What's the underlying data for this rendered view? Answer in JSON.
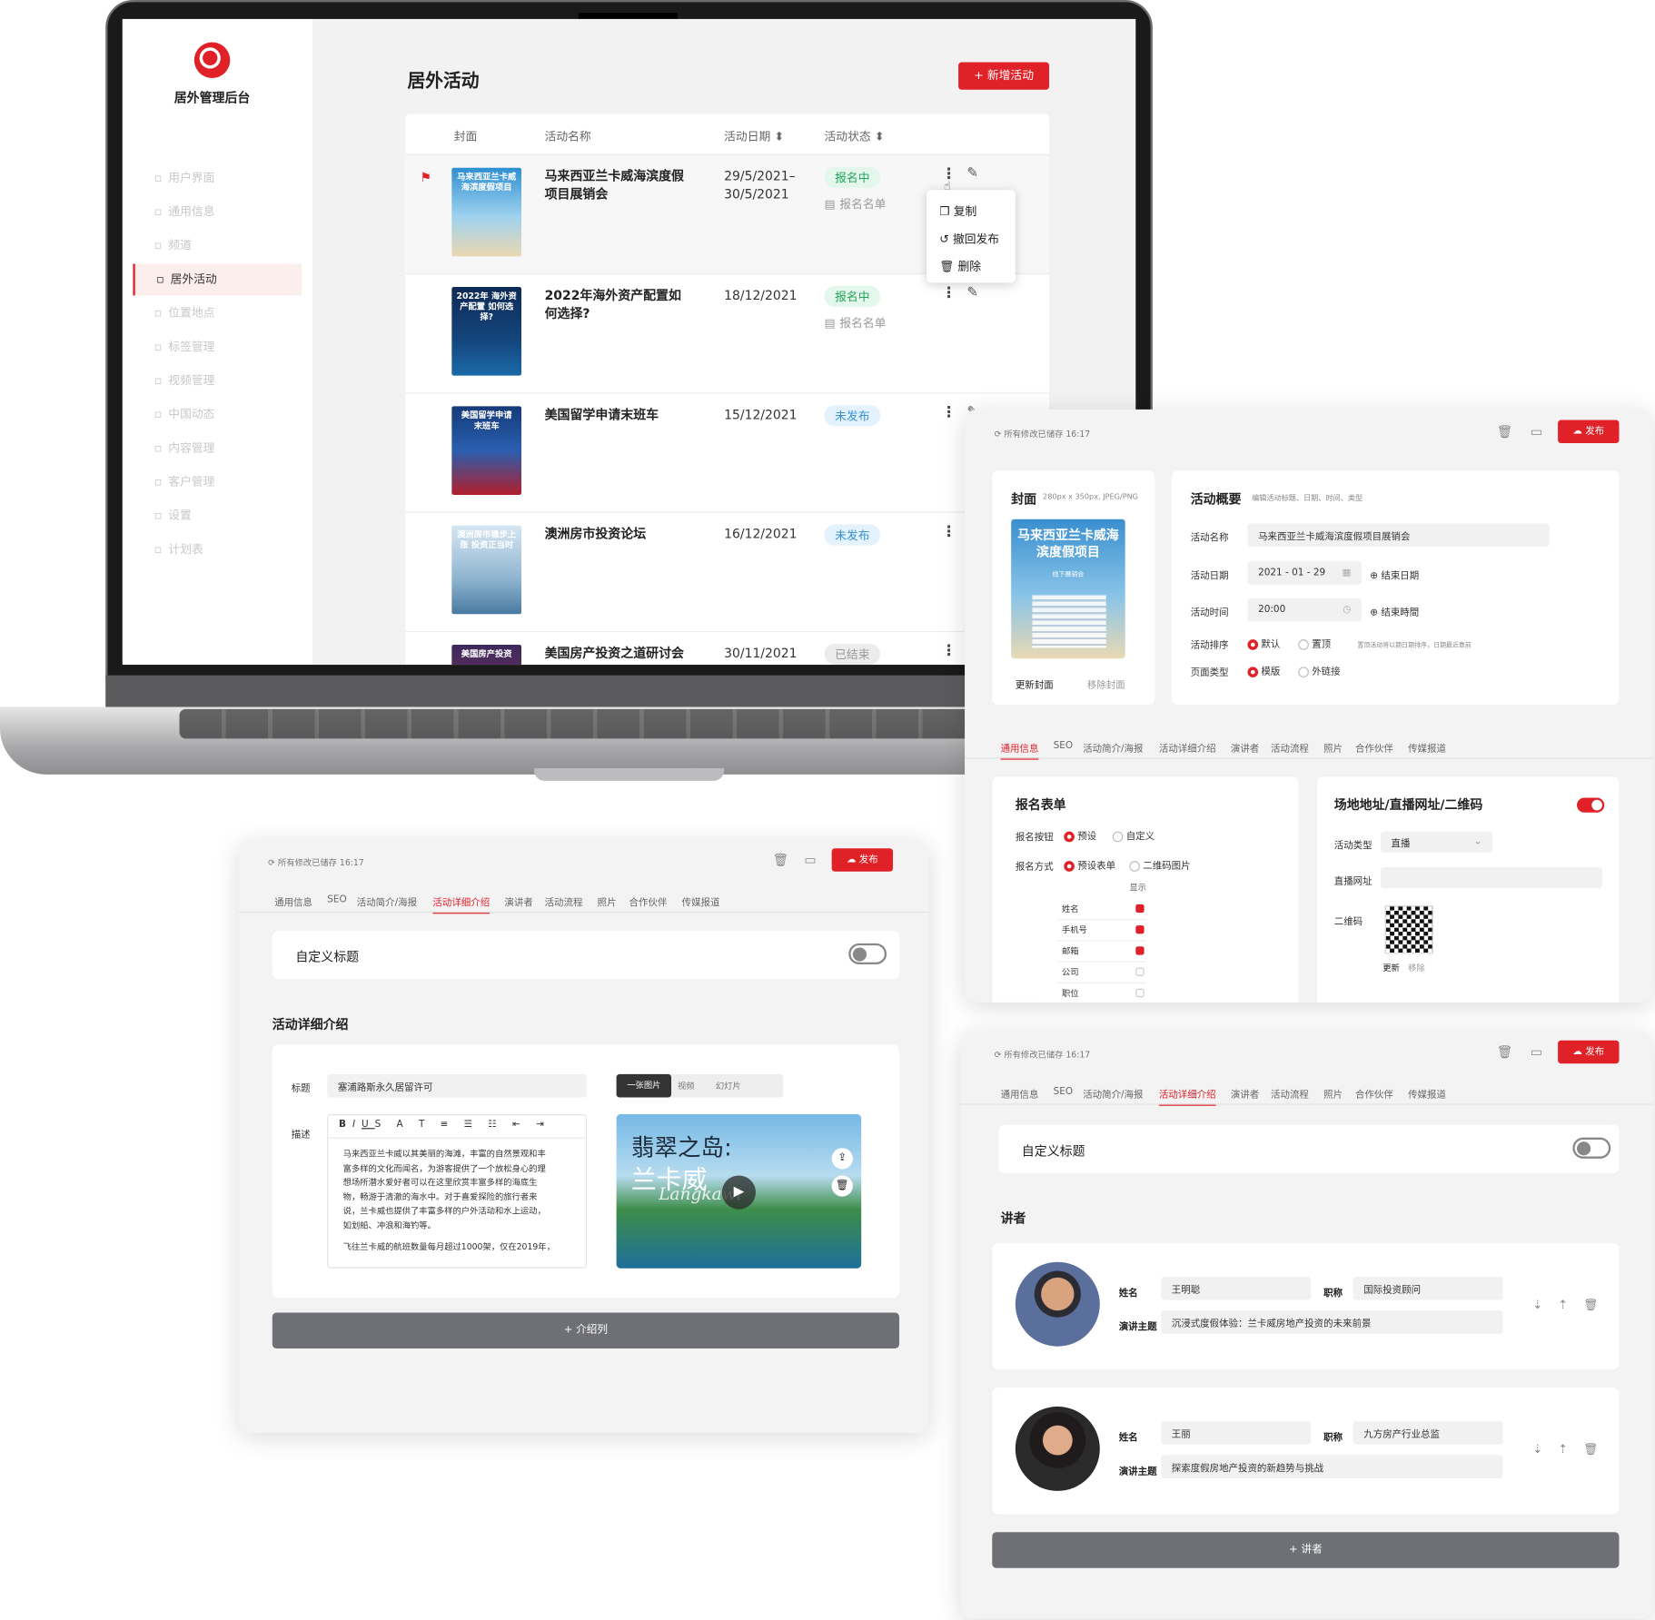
{
  "sidebar": {
    "app_title": "居外管理后台",
    "items": [
      "用户界面",
      "通用信息",
      "频道",
      "居外活动",
      "位置地点",
      "标签管理",
      "视频管理",
      "中国动态",
      "内容管理",
      "客户管理",
      "设置",
      "计划表"
    ],
    "active_index": 3
  },
  "list": {
    "title": "居外活动",
    "add_button": "+ 新增活动",
    "columns": [
      "封面",
      "活动名称",
      "活动日期",
      "活动状态"
    ],
    "rows": [
      {
        "name": "马来西亚兰卡威海滨度假项目展销会",
        "date": "29/5/2021–30/5/2021",
        "status": "报名中",
        "sub": "报名名单",
        "flag": true,
        "cover_text": "马来西亚兰卡威海滨度假项目"
      },
      {
        "name": "2022年海外资产配置如何选择?",
        "date": "18/12/2021",
        "status": "报名中",
        "sub": "报名名单",
        "cover_text": "2022年 海外资产配置 如何选择?"
      },
      {
        "name": "美国留学申请末班车",
        "date": "15/12/2021",
        "status": "未发布",
        "cover_text": "美国留学申请 末班车"
      },
      {
        "name": "澳洲房市投资论坛",
        "date": "16/12/2021",
        "status": "未发布",
        "cover_text": "澳洲房市稳步上涨 投资正当时"
      },
      {
        "name": "美国房产投资之道研讨会",
        "date": "30/11/2021",
        "status": "已结束",
        "cover_text": "美国房产投资"
      }
    ],
    "menu": [
      "复制",
      "撤回发布",
      "删除"
    ]
  },
  "common": {
    "saved": "所有修改已储存 16:17",
    "publish": "发布",
    "tabs": [
      "通用信息",
      "SEO",
      "活动简介/海报",
      "活动详细介绍",
      "演讲者",
      "活动流程",
      "照片",
      "合作伙伴",
      "传媒报道"
    ]
  },
  "overview": {
    "cover_title": "封面",
    "cover_hint": "280px x 350px, JPEG/PNG",
    "cover_text": "马来西亚兰卡威海滨度假项目",
    "cover_sub": "线下展销会",
    "update_cover": "更新封面",
    "remove_cover": "移除封面",
    "title": "活动概要",
    "hint": "编辑活动标题、日期、时间、类型",
    "name_label": "活动名称",
    "name_value": "马来西亚兰卡威海滨度假项目展销会",
    "date_label": "活动日期",
    "date_value": "2021 - 01 - 29",
    "end_date": "结束日期",
    "time_label": "活动时间",
    "time_value": "20:00",
    "end_time": "结束時間",
    "sort_label": "活动排序",
    "sort_opts": [
      "默认",
      "置顶"
    ],
    "sort_hint": "置顶活动将以期日期排序，日期最近靠前",
    "page_label": "页面类型",
    "page_opts": [
      "模版",
      "外链接"
    ],
    "form_title": "报名表单",
    "form_btn_label": "报名按钮",
    "form_btn_opts": [
      "预设",
      "自定义"
    ],
    "form_mode_label": "报名方式",
    "form_mode_opts": [
      "预设表单",
      "二维码图片"
    ],
    "show_header": "显示",
    "fields": [
      "姓名",
      "手机号",
      "邮箱",
      "公司",
      "职位"
    ],
    "venue_title": "场地地址/直播网址/二维码",
    "type_label": "活动类型",
    "type_value": "直播",
    "url_label": "直播网址",
    "qr_label": "二维码",
    "qr_update": "更新",
    "qr_remove": "移除"
  },
  "detail": {
    "custom_title": "自定义标题",
    "section": "活动详细介绍",
    "title_label": "标题",
    "title_value": "塞浦路斯永久居留许可",
    "desc_label": "描述",
    "para1": [
      "马来西亚兰卡威以其美丽的海滩，丰富的自然景观和丰",
      "富多样的文化而闻名，为游客提供了一个放松身心的理",
      "想场所潜水爱好者可以在这里欣赏丰富多样的海底生",
      "物，畅游于清澈的海水中。对于喜爱探险的旅行者来",
      "说，兰卡威也提供了丰富多样的户外活动和水上运动，",
      "如划船、冲浪和海钓等。"
    ],
    "para2": "飞往兰卡威的航班数量每月超过1000架，仅在2019年，",
    "media_tabs": [
      "一张图片",
      "视频",
      "幻灯片"
    ],
    "image_title1": "翡翠之岛:",
    "image_title2": "兰卡威",
    "image_script": "Langkawi",
    "add_intro": "+ 介绍列"
  },
  "speakers": {
    "custom_title": "自定义标题",
    "section": "讲者",
    "name_label": "姓名",
    "job_label": "职称",
    "topic_label": "演讲主题",
    "list": [
      {
        "name": "王明聪",
        "job": "国际投资顾问",
        "topic": "沉浸式度假体验：兰卡威房地产投资的未来前景"
      },
      {
        "name": "王丽",
        "job": "九方房产行业总监",
        "topic": "探索度假房地产投资的新趋势与挑战"
      }
    ],
    "add": "+ 讲者"
  },
  "colors": {
    "accent": "#e02128",
    "green": "#23a35a",
    "blue": "#3590d4"
  }
}
